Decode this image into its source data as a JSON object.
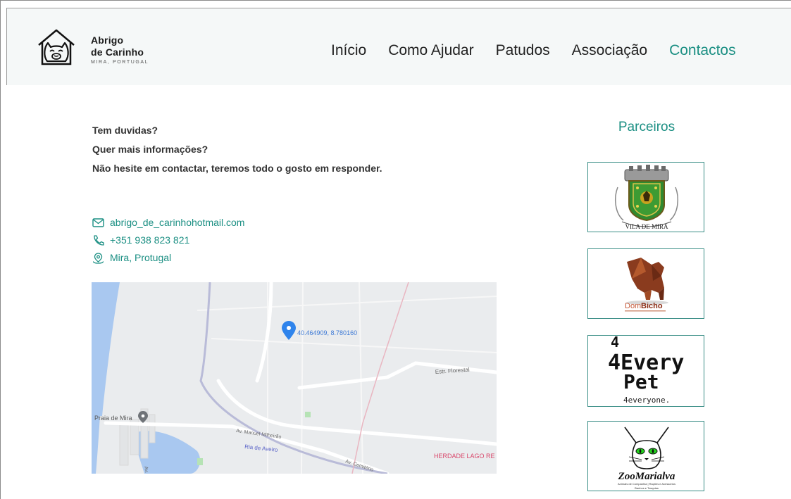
{
  "brand": {
    "line1": "Abrigo",
    "line2": "de Carinho",
    "subtitle": "MIRA, PORTUGAL"
  },
  "nav": {
    "items": [
      {
        "label": "Início"
      },
      {
        "label": "Como Ajudar"
      },
      {
        "label": "Patudos"
      },
      {
        "label": "Associação"
      },
      {
        "label": "Contactos",
        "active": true
      }
    ]
  },
  "contact": {
    "questions": [
      "Tem duvidas?",
      "Quer mais informações?",
      "Não hesite em contactar, teremos todo o gosto em responder."
    ],
    "email": "abrigo_de_carinhohotmail.com",
    "phone": "+351 938 823 821",
    "location": "Mira, Protugal"
  },
  "map": {
    "pin_label": "40.464909, 8.780160",
    "place_praia": "Praia de Mira",
    "road_florestal": "Estr. Florestal",
    "road_manuel": "Av. Manuel Milheirão",
    "river": "Ria de Aveiro",
    "road_cemiterio": "Av. Cemitério",
    "road_left": "Av. Ma",
    "herdade": "HERDADE LAGO RE"
  },
  "partners": {
    "title": "Parceiros",
    "vila": {
      "text": "VILA DE MIRA"
    },
    "dombicho": {
      "text_part1": "Dom",
      "text_part2": "Bicho"
    },
    "everypet": {
      "line1": "4Every",
      "line2": "Pet",
      "footer": "4everyone."
    },
    "zoomarialva": {
      "name": "ZooMarialva",
      "sub1": "Animais de Companhia | Rações e Acessórios",
      "sub2": "Banhos e Tosquias"
    }
  },
  "colors": {
    "accent": "#1b8f83",
    "header_bg": "#f5f8f8",
    "map_water": "#a9c8f0",
    "map_land": "#eaecee"
  }
}
